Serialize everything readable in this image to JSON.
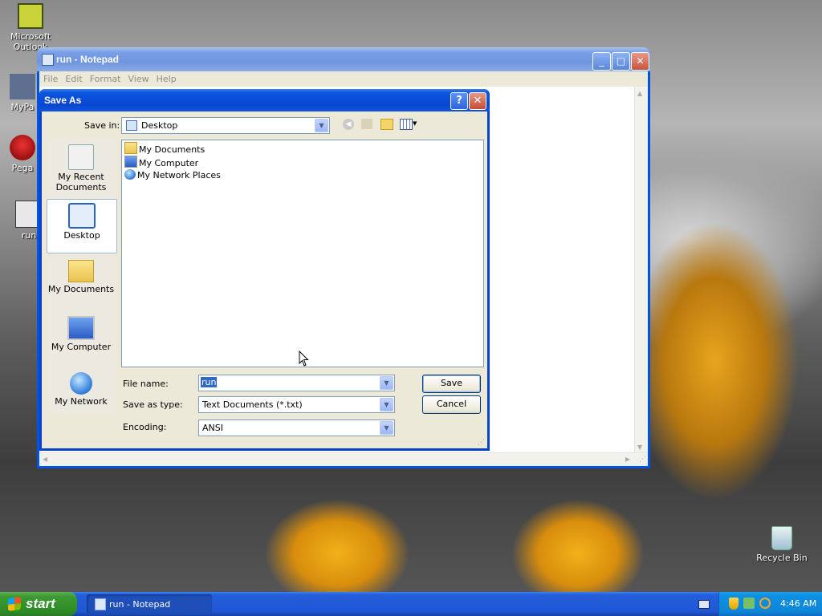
{
  "desktop": {
    "icons": [
      {
        "label_l1": "Microsoft",
        "label_l2": "Outlook"
      },
      {
        "label": "MyPa"
      },
      {
        "label": "Pega"
      },
      {
        "label": "run"
      },
      {
        "label": "Recycle Bin"
      }
    ]
  },
  "notepad": {
    "title": "run - Notepad",
    "menu": [
      "File",
      "Edit",
      "Format",
      "View",
      "Help"
    ]
  },
  "dialog": {
    "title": "Save As",
    "save_in_label": "Save in:",
    "save_in_value": "Desktop",
    "places": [
      {
        "l1": "My Recent",
        "l2": "Documents"
      },
      {
        "l1": "Desktop"
      },
      {
        "l1": "My Documents"
      },
      {
        "l1": "My Computer"
      },
      {
        "l1": "My Network"
      }
    ],
    "files": [
      "My Documents",
      "My Computer",
      "My Network Places"
    ],
    "file_name_label": "File name:",
    "file_name_value": "run",
    "save_as_type_label": "Save as type:",
    "save_as_type_value": "Text Documents (*.txt)",
    "encoding_label": "Encoding:",
    "encoding_value": "ANSI",
    "save_button": "Save",
    "cancel_button": "Cancel"
  },
  "taskbar": {
    "start_label": "start",
    "task_label": "run - Notepad",
    "clock": "4:46 AM"
  }
}
